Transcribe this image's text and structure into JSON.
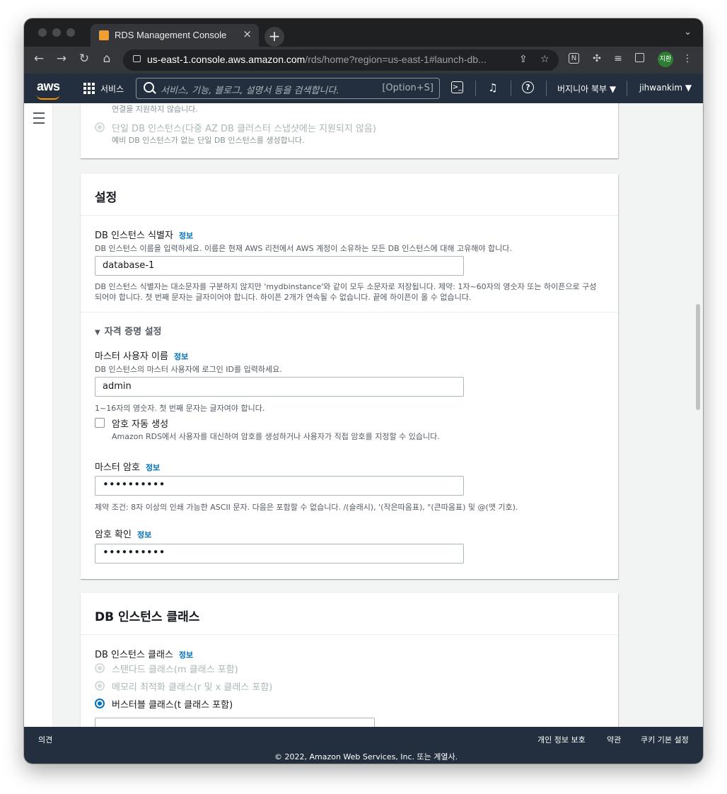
{
  "browser": {
    "tab_title": "RDS Management Console",
    "tab_close": "×",
    "new_tab": "+",
    "tab_menu": "⌄",
    "url_host": "us-east-1.console.aws.amazon.com",
    "url_path": "/rds/home?region=us-east-1#launch-db...",
    "profile_initials": "지환"
  },
  "aws_header": {
    "logo": "aws",
    "services_label": "서비스",
    "search_placeholder": "서비스, 기능, 블로그, 설명서 등을 검색합니다.",
    "search_shortcut": "[Option+S]",
    "region": "버지니아 북부 ▼",
    "user": "jihwankim ▼"
  },
  "availability_panel": {
    "cut_off_text": "연결을 지원하지 않습니다.",
    "option_label": "단일 DB 인스턴스(다중 AZ DB 클러스터 스냅샷에는 지원되지 않음)",
    "option_desc": "예비 DB 인스턴스가 없는 단일 DB 인스턴스를 생성합니다."
  },
  "settings": {
    "title": "설정",
    "identifier_label": "DB 인스턴스 식별자",
    "info_link": "정보",
    "identifier_desc": "DB 인스턴스 이름을 입력하세요. 이름은 현재 AWS 리전에서 AWS 계정이 소유하는 모든 DB 인스턴스에 대해 고유해야 합니다.",
    "identifier_value": "database-1",
    "identifier_constraint_1": "DB 인스턴스 식별자는 대소문자를 구분하지 않지만 'mydbinstance'와 같이 모두 소문자로 저장됩니다. 제약: 1자~60자의 영숫자 또는 하이픈으로 구성",
    "identifier_constraint_2": "되어야 합니다. 첫 번째 문자는 글자이어야 합니다. 하이픈 2개가 연속될 수 없습니다. 끝에 하이픈이 올 수 없습니다.",
    "credentials_toggle": "자격 증명 설정",
    "master_user_label": "마스터 사용자 이름",
    "master_user_desc": "DB 인스턴스의 마스터 사용자에 로그인 ID를 입력하세요.",
    "master_user_value": "admin",
    "master_user_constraint": "1~16자의 영숫자. 첫 번째 문자는 글자여야 합니다.",
    "auto_password_label": "암호 자동 생성",
    "auto_password_desc": "Amazon RDS에서 사용자를 대신하여 암호를 생성하거나 사용자가 직접 암호를 지정할 수 있습니다.",
    "master_password_label": "마스터 암호",
    "master_password_value": "••••••••••",
    "password_constraint": "제약 조건: 8자 이상의 인쇄 가능한 ASCII 문자. 다음은 포함할 수 없습니다. /(슬래시), '(작은따옴표), \"(큰따옴표) 및 @(앳 기호).",
    "confirm_password_label": "암호 확인",
    "confirm_password_value": "••••••••••"
  },
  "instance_class": {
    "title": "DB 인스턴스 클래스",
    "label": "DB 인스턴스 클래스",
    "options": [
      "스탠다드 클래스(m 클래스 포함)",
      "메모리 최적화 클래스(r 및 x 클래스 포함)",
      "버스터블 클래스(t 클래스 포함)"
    ]
  },
  "footer": {
    "feedback": "의견",
    "privacy": "개인 정보 보호",
    "terms": "약관",
    "cookies": "쿠키 기본 설정",
    "copyright": "© 2022, Amazon Web Services, Inc. 또는 계열사."
  },
  "colors": {
    "aws_navy": "#232f3e",
    "aws_orange": "#ff9900",
    "link_blue": "#0073bb"
  }
}
